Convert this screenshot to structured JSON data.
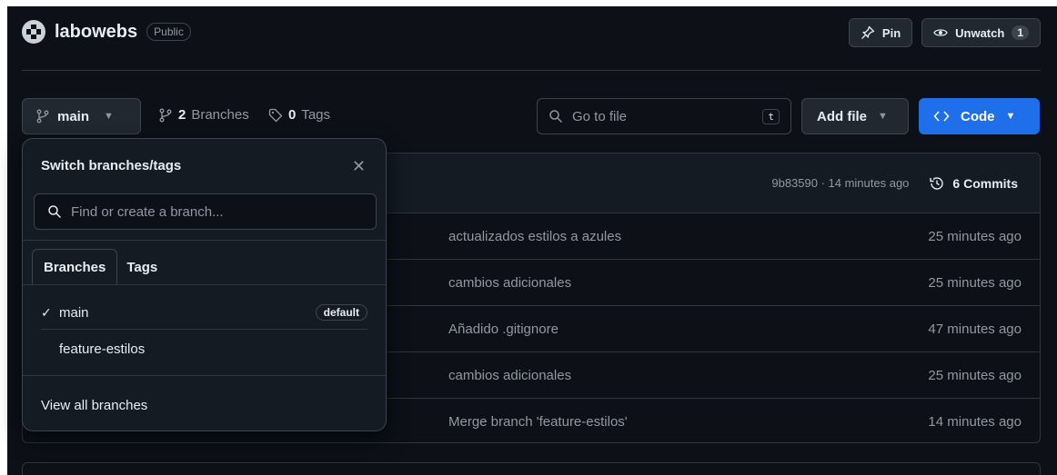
{
  "repo": {
    "name": "labowebs",
    "visibility": "Public",
    "pin_label": "Pin",
    "watch_label": "Unwatch",
    "watch_count": "1"
  },
  "toolbar": {
    "branch": "main",
    "branches_count": "2",
    "branches_label": "Branches",
    "tags_count": "0",
    "tags_label": "Tags",
    "goto_placeholder": "Go to file",
    "goto_shortcut": "t",
    "add_file_label": "Add file",
    "code_label": "Code"
  },
  "latest_commit": {
    "hash_time": "9b83590 · 14 minutes ago",
    "commits_label": "6 Commits"
  },
  "rows": [
    {
      "message": "actualizados estilos a azules",
      "time": "25 minutes ago"
    },
    {
      "message": "cambios adicionales",
      "time": "25 minutes ago"
    },
    {
      "message": "Añadido .gitignore",
      "time": "47 minutes ago"
    },
    {
      "message": "cambios adicionales",
      "time": "25 minutes ago"
    },
    {
      "message": "Merge branch 'feature-estilos'",
      "time": "14 minutes ago"
    }
  ],
  "dropdown": {
    "title": "Switch branches/tags",
    "search_placeholder": "Find or create a branch...",
    "tabs": [
      "Branches",
      "Tags"
    ],
    "branches": [
      {
        "name": "main",
        "badge": "default",
        "selected": true
      },
      {
        "name": "feature-estilos",
        "badge": "",
        "selected": false
      }
    ],
    "footer": "View all branches"
  },
  "colors": {
    "background": "#0d1117",
    "accent": "#1f6feb",
    "muted": "#9198a1"
  }
}
